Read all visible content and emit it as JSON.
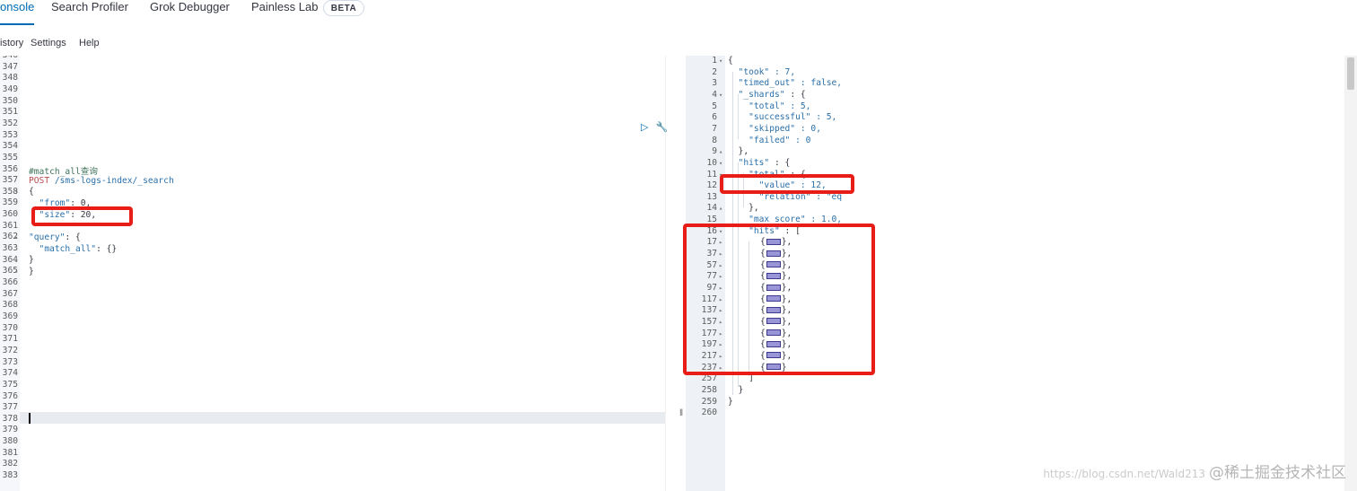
{
  "tabs": [
    {
      "label": "onsole",
      "active": true
    },
    {
      "label": "Search Profiler",
      "active": false
    },
    {
      "label": "Grok Debugger",
      "active": false
    },
    {
      "label": "Painless Lab",
      "active": false
    }
  ],
  "beta_badge": "BETA",
  "menu": [
    "istory",
    "Settings",
    "Help"
  ],
  "request_editor": {
    "line_numbers": [
      "346",
      "347",
      "348",
      "349",
      "350",
      "351",
      "352",
      "353",
      "354",
      "355",
      "356",
      "357",
      "358",
      "359",
      "360",
      "361",
      "362",
      "363",
      "364",
      "365",
      "366",
      "367",
      "368",
      "369",
      "370",
      "371",
      "372",
      "373",
      "374",
      "375",
      "376",
      "377",
      "378",
      "379",
      "380",
      "381",
      "382",
      "383"
    ],
    "lines": {
      "comment": "#match_all查询",
      "method": "POST",
      "path": " /sms-logs-index/_search",
      "open_brace": "{",
      "from_key": "  \"from\"",
      "from_val": ": 0,",
      "size_key": "  \"size\"",
      "size_val": ": 20,",
      "query_key": "\"query\"",
      "query_val": ": {",
      "match_all_key": "  \"match_all\"",
      "match_all_val": ": {}",
      "inner_close": "}",
      "outer_close": "}"
    },
    "icons": [
      "play-icon",
      "wrench-icon"
    ]
  },
  "response_editor": {
    "line_numbers": [
      "1",
      "2",
      "3",
      "4",
      "5",
      "6",
      "7",
      "8",
      "9",
      "10",
      "11",
      "12",
      "13",
      "14",
      "15",
      "16",
      "17",
      "37",
      "57",
      "77",
      "97",
      "117",
      "137",
      "157",
      "177",
      "197",
      "217",
      "237",
      "257",
      "258",
      "259",
      "260"
    ],
    "lines": {
      "l1": "{",
      "took_key": "  \"took\"",
      "took_val": " : 7,",
      "timed_key": "  \"timed_out\"",
      "timed_val": " : false,",
      "shards_key": "  \"_shards\"",
      "shards_val": " : {",
      "total_key": "    \"total\"",
      "total_val": " : 5,",
      "succ_key": "    \"successful\"",
      "succ_val": " : 5,",
      "skip_key": "    \"skipped\"",
      "skip_val": " : 0,",
      "fail_key": "    \"failed\"",
      "fail_val": " : 0",
      "shards_close": "  },",
      "hits_key": "  \"hits\"",
      "hits_val": " : {",
      "htotal_key": "    \"total\"",
      "htotal_val": " : {",
      "value_key": "      \"value\"",
      "value_val": " : 12,",
      "relation_key": "      \"relation\"",
      "relation_val": " : \"eq",
      "htotal_close": "    },",
      "maxscore_key": "    \"max_score\"",
      "maxscore_val": " : 1.0,",
      "hits_arr_key": "    \"hits\"",
      "hits_arr_val": " : [",
      "arr_close": "    ]",
      "hits_close": "  }",
      "root_close": "}"
    },
    "collapsed_hit_count": 12
  },
  "watermark": {
    "url": "https://blog.csdn.net/Wald213",
    "text": "@稀土掘金技术社区"
  },
  "colors": {
    "accent": "#006bb4",
    "callout": "#e81d17",
    "collapsed_marker": "#9a95d6"
  }
}
